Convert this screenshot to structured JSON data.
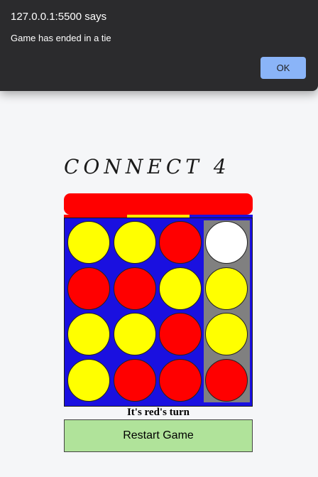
{
  "dialog": {
    "origin": "127.0.0.1:5500 says",
    "message": "Game has ended in a tie",
    "ok_label": "OK"
  },
  "game": {
    "title": "CONNECT 4",
    "turn_text": "It's red's turn",
    "restart_label": "Restart Game",
    "board": [
      [
        "yellow",
        "yellow",
        "red",
        "white"
      ],
      [
        "red",
        "red",
        "yellow",
        "yellow"
      ],
      [
        "yellow",
        "yellow",
        "red",
        "yellow"
      ],
      [
        "yellow",
        "red",
        "red",
        "red"
      ]
    ],
    "highlighted_column": 3,
    "current_player": "red"
  },
  "colors": {
    "red": "#ff0000",
    "yellow": "#ffff00",
    "white": "#ffffff",
    "board": "#1a10e0",
    "highlight": "#808080",
    "restart": "#b0e39a",
    "indicator": [
      "#ff0000",
      "#ffe600",
      "#1a10e0"
    ]
  }
}
